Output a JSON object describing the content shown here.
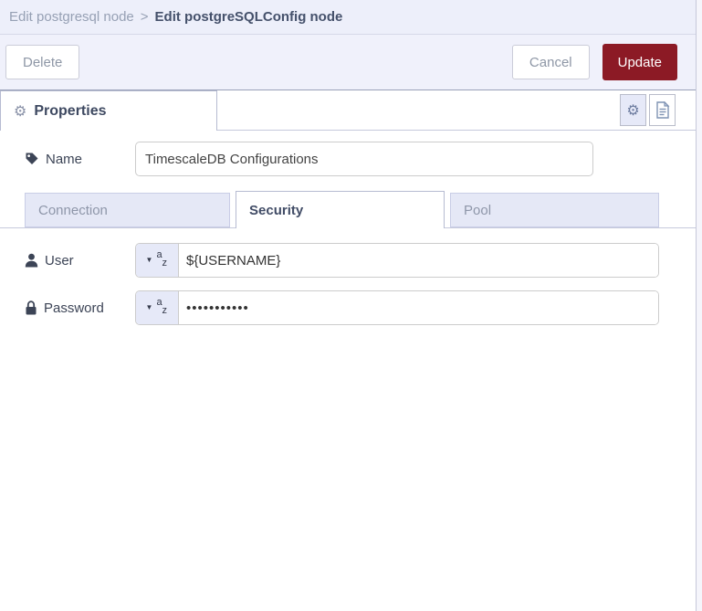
{
  "breadcrumb": {
    "parent": "Edit postgresql node",
    "separator": ">",
    "current": "Edit postgreSQLConfig node"
  },
  "toolbar": {
    "delete_label": "Delete",
    "cancel_label": "Cancel",
    "update_label": "Update"
  },
  "properties_strip": {
    "tab_label": "Properties",
    "icon_buttons": [
      {
        "name": "edit-properties",
        "icon": "gear-icon",
        "selected": true
      },
      {
        "name": "description",
        "icon": "document-icon",
        "selected": false
      }
    ]
  },
  "form": {
    "name_field": {
      "label": "Name",
      "icon": "tag-icon",
      "value": "TimescaleDB Configurations"
    },
    "section_tabs": [
      {
        "label": "Connection",
        "active": false
      },
      {
        "label": "Security",
        "active": true
      },
      {
        "label": "Pool",
        "active": false
      }
    ],
    "user_field": {
      "label": "User",
      "icon": "user-icon",
      "type": "string",
      "value": "${USERNAME}"
    },
    "password_field": {
      "label": "Password",
      "icon": "lock-icon",
      "type": "string",
      "value": "•••••••••••"
    }
  },
  "icons": {
    "gear": "⚙",
    "caret_down": "▼",
    "az_a": "a",
    "az_z": "z"
  },
  "colors": {
    "accent_red": "#8c1a25",
    "header_bg": "#edeffa",
    "button_bar_bg": "#f0f1fb",
    "inactive_tab_bg": "#e5e8f6",
    "selected_icon_btn_bg": "#e6e9f8",
    "label_text": "#3c4456",
    "active_tab_text": "#414c66",
    "muted_text": "#8e96a9"
  }
}
